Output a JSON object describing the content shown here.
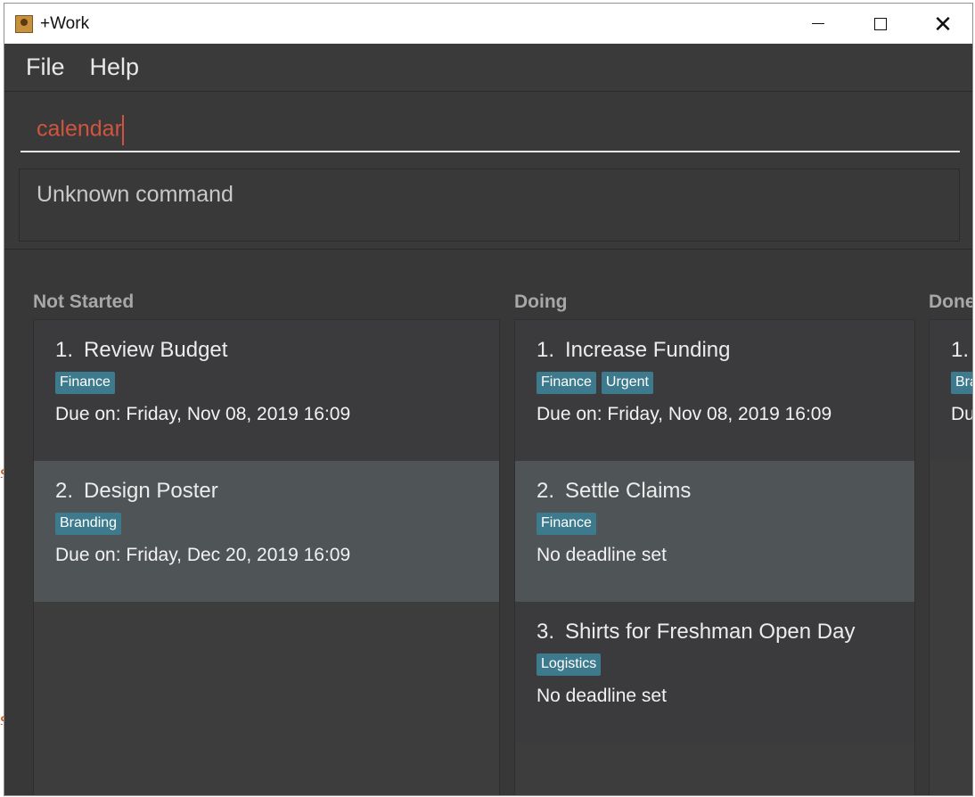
{
  "window": {
    "title": "+Work"
  },
  "menu": {
    "file_label": "File",
    "help_label": "Help"
  },
  "command_box": {
    "value": "calendar"
  },
  "result_display": {
    "text": "Unknown command"
  },
  "columns": [
    {
      "header": "Not Started",
      "tasks": [
        {
          "index": "1.",
          "name": "Review Budget",
          "tags": [
            "Finance"
          ],
          "due": "Due on: Friday, Nov 08, 2019 16:09"
        },
        {
          "index": "2.",
          "name": "Design Poster",
          "tags": [
            "Branding"
          ],
          "due": "Due on: Friday, Dec 20, 2019 16:09"
        }
      ]
    },
    {
      "header": "Doing",
      "tasks": [
        {
          "index": "1.",
          "name": "Increase Funding",
          "tags": [
            "Finance",
            "Urgent"
          ],
          "due": "Due on: Friday, Nov 08, 2019 16:09"
        },
        {
          "index": "2.",
          "name": "Settle Claims",
          "tags": [
            "Finance"
          ],
          "due": "No deadline set"
        },
        {
          "index": "3.",
          "name": "Shirts for Freshman Open Day",
          "tags": [
            "Logistics"
          ],
          "due": "No deadline set"
        }
      ]
    },
    {
      "header": "Done",
      "tasks": [
        {
          "index": "1.",
          "name": "",
          "tags": [
            "Bra"
          ],
          "due": "Du"
        }
      ]
    }
  ],
  "colors": {
    "background": "#393939",
    "command_text": "#d2543f",
    "tag": "#3e7a8d",
    "selected_card": "#4f5457"
  }
}
